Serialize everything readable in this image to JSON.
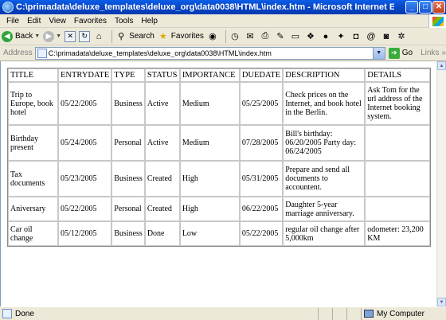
{
  "window": {
    "title": "C:\\primadata\\deluxe_templates\\deluxe_org\\data0038\\HTML\\index.htm - Microsoft Internet Explorer provided b...",
    "min_glyph": "_",
    "max_glyph": "□",
    "close_glyph": "✕"
  },
  "menu": [
    "File",
    "Edit",
    "View",
    "Favorites",
    "Tools",
    "Help"
  ],
  "toolbar": {
    "back_label": "Back",
    "search_label": "Search",
    "favorites_label": "Favorites"
  },
  "address": {
    "label": "Address",
    "value": "C:\\primadata\\deluxe_templates\\deluxe_org\\data0038\\HTML\\index.htm",
    "go_label": "Go",
    "links_label": "Links"
  },
  "table": {
    "headers": [
      "TITLE",
      "ENTRYDATE",
      "TYPE",
      "STATUS",
      "IMPORTANCE",
      "DUEDATE",
      "DESCRIPTION",
      "DETAILS"
    ],
    "rows": [
      [
        "Trip to Europe, book hotel",
        "05/22/2005",
        "Business",
        "Active",
        "Medium",
        "05/25/2005",
        "Check prices on the Internet, and book hotel in the Berlin.",
        "Ask Tom for the url address of the Internet booking system."
      ],
      [
        "Birthday present",
        "05/24/2005",
        "Personal",
        "Active",
        "Medium",
        "07/28/2005",
        "Bill's birthday: 06/20/2005 Party day: 06/24/2005",
        ""
      ],
      [
        "Tax documents",
        "05/23/2005",
        "Business",
        "Created",
        "High",
        "05/31/2005",
        "Prepare and send all documents to accountent.",
        ""
      ],
      [
        "Aniversary",
        "05/22/2005",
        "Personal",
        "Created",
        "High",
        "06/22/2005",
        "Daughter 5-year marriage anniversary.",
        ""
      ],
      [
        "Car oil change",
        "05/12/2005",
        "Business",
        "Done",
        "Low",
        "05/22/2005",
        "regular oil change after 5,000km",
        "odometer: 23,200 KM"
      ]
    ]
  },
  "status": {
    "text": "Done",
    "zone": "My Computer"
  }
}
